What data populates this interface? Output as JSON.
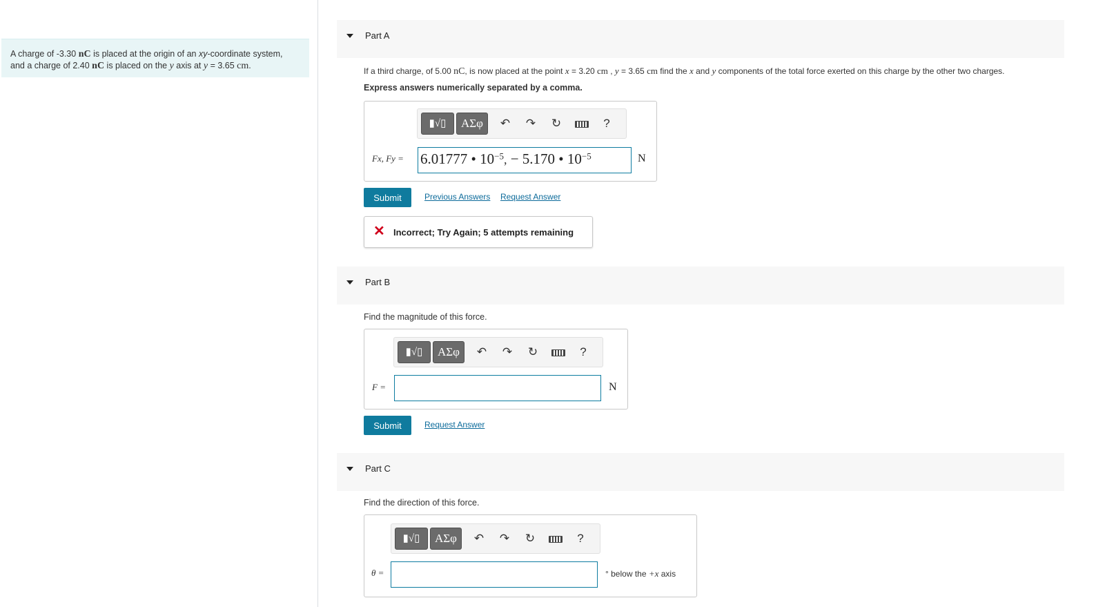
{
  "intro": {
    "line1_a": "A charge of -3.30 ",
    "unit_nC": "nC",
    "line1_b": " is placed at the origin of an ",
    "xy": "xy",
    "line1_c": "-coordinate system,",
    "line2_a": "and a charge of 2.40 ",
    "line2_b": " is placed on the ",
    "y": "y",
    "line2_c": " axis at ",
    "line2_d": " = 3.65 ",
    "unit_cm": "cm",
    "line2_e": "."
  },
  "toolbar": {
    "template_label": "▮√▯",
    "symbols_label": "ΑΣφ",
    "undo": "↶",
    "redo": "↷",
    "reset": "↻",
    "help": "?"
  },
  "partA": {
    "title": "Part A",
    "prompt_a": "If a third charge, of 5.00 ",
    "prompt_b": ", is now placed at the point ",
    "x": "x",
    "prompt_c": " = 3.20 ",
    "prompt_d": " , ",
    "prompt_e": " = 3.65 ",
    "prompt_f": " find the ",
    "prompt_g": " and ",
    "prompt_h": " components of the total force exerted on this charge by the other two charges.",
    "instruction": "Express answers numerically separated by a comma.",
    "var_label": "Fx, Fy =",
    "answer_val1": "6.01777 • 10",
    "answer_exp1": "−5",
    "answer_comma": ",",
    "answer_val2": " − 5.170 • 10",
    "answer_exp2": "−5",
    "unit": "N",
    "submit": "Submit",
    "previous_answers": "Previous Answers",
    "request_answer": "Request Answer",
    "feedback": "Incorrect; Try Again; 5 attempts remaining"
  },
  "partB": {
    "title": "Part B",
    "prompt": "Find the magnitude of this force.",
    "var_label": "F =",
    "unit": "N",
    "submit": "Submit",
    "request_answer": "Request Answer"
  },
  "partC": {
    "title": "Part C",
    "prompt": "Find the direction of this force.",
    "var_label": "θ =",
    "unit_a": "° below the ",
    "unit_b": "+x",
    "unit_c": " axis"
  }
}
